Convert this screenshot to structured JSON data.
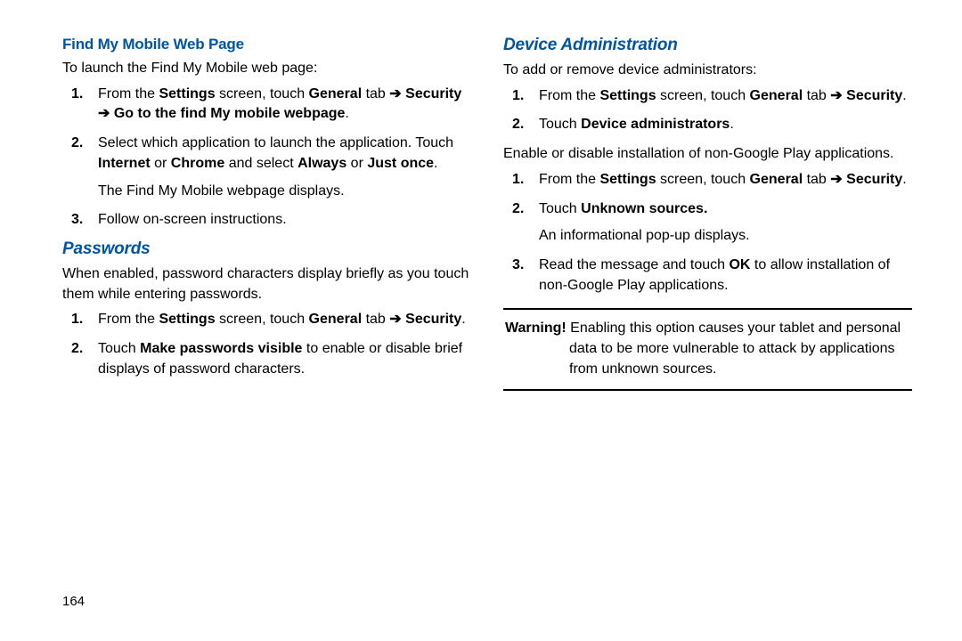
{
  "page_number": "164",
  "left": {
    "section1": {
      "heading": "Find My Mobile Web Page",
      "intro": "To launch the Find My Mobile web page:",
      "step1_a": "From the ",
      "step1_b": "Settings",
      "step1_c": " screen, touch ",
      "step1_d": "General",
      "step1_e": " tab ",
      "step1_f": "Security",
      "step1_g": "Go to the find My mobile webpage",
      "step1_end": ".",
      "step2_a": "Select which application to launch the application. Touch ",
      "step2_b": "Internet",
      "step2_c": " or ",
      "step2_d": "Chrome",
      "step2_e": " and select ",
      "step2_f": "Always",
      "step2_g": " or ",
      "step2_h": "Just once",
      "step2_end": ".",
      "step2_sub": "The Find My Mobile webpage displays.",
      "step3": "Follow on-screen instructions."
    },
    "section2": {
      "heading": "Passwords",
      "intro": "When enabled, password characters display briefly as you touch them while entering passwords.",
      "step1_a": "From the ",
      "step1_b": "Settings",
      "step1_c": " screen, touch ",
      "step1_d": "General",
      "step1_e": " tab ",
      "step1_f": "Security",
      "step1_end": ".",
      "step2_a": "Touch ",
      "step2_b": "Make passwords visible",
      "step2_c": " to enable or disable brief displays of password characters."
    }
  },
  "right": {
    "section1": {
      "heading": "Device Administration",
      "intro": "To add or remove device administrators:",
      "step1_a": "From the ",
      "step1_b": "Settings",
      "step1_c": " screen, touch ",
      "step1_d": "General",
      "step1_e": " tab ",
      "step1_f": "Security",
      "step1_end": ".",
      "step2_a": "Touch ",
      "step2_b": "Device administrators",
      "step2_end": ".",
      "middle": "Enable or disable installation of non-Google Play applications.",
      "b_step1_a": "From the ",
      "b_step1_b": "Settings",
      "b_step1_c": " screen, touch ",
      "b_step1_d": "General",
      "b_step1_e": " tab ",
      "b_step1_f": "Security",
      "b_step1_end": ".",
      "b_step2_a": "Touch ",
      "b_step2_b": "Unknown sources.",
      "b_step2_sub": "An informational pop-up displays.",
      "b_step3_a": "Read the message and touch ",
      "b_step3_b": "OK",
      "b_step3_c": " to allow installation of non-Google Play applications."
    },
    "warning": {
      "label": "Warning!",
      "text": " Enabling this option causes your tablet and personal data to be more vulnerable to attack by applications from unknown sources."
    }
  },
  "arrow": "➔"
}
